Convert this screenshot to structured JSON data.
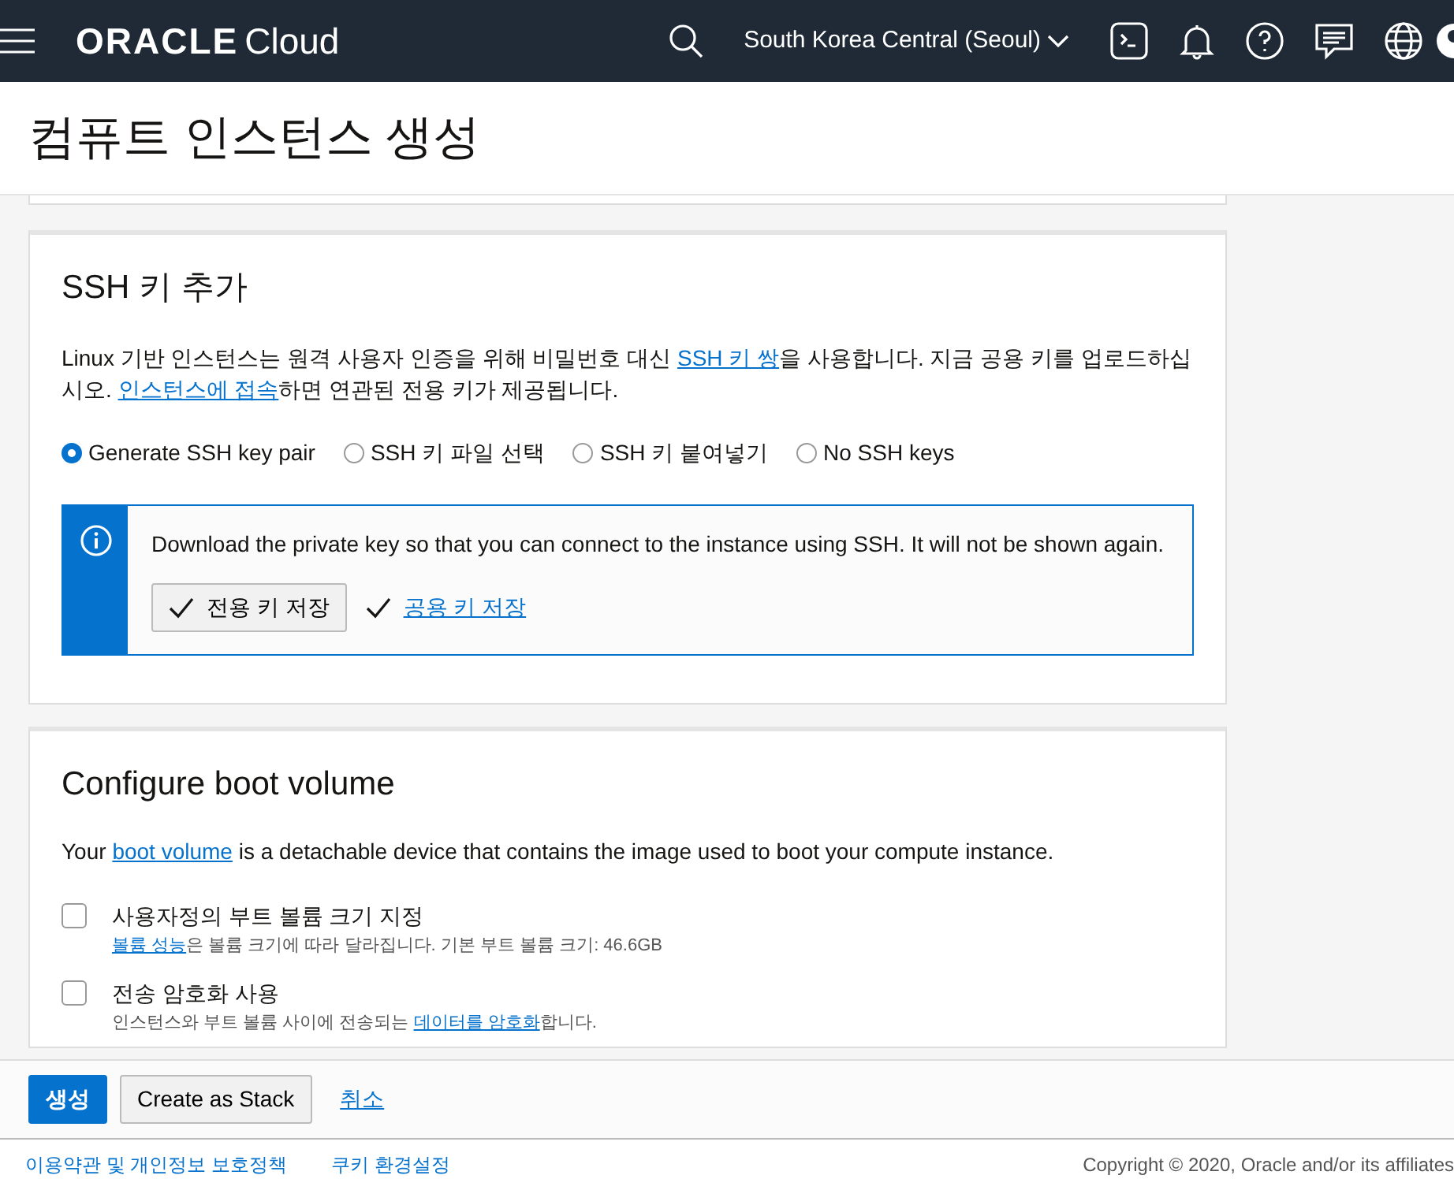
{
  "header": {
    "brand_main": "ORACLE",
    "brand_sub": "Cloud",
    "region": "South Korea Central (Seoul)"
  },
  "page_title": "컴퓨트 인스턴스 생성",
  "ssh_section": {
    "title": "SSH 키 추가",
    "description": [
      {
        "text": "Linux 기반 인스턴스는 원격 사용자 인증을 위해 비밀번호 대신 ",
        "link": false
      },
      {
        "text": "SSH 키 쌍",
        "link": true
      },
      {
        "text": "을 사용합니다. 지금 공용 키를 업로드하십시오. ",
        "link": false
      },
      {
        "text": "인스턴스에 접속",
        "link": true
      },
      {
        "text": "하면 연관된 전용 키가 제공됩니다.",
        "link": false
      }
    ],
    "options": [
      {
        "label": "Generate SSH key pair",
        "selected": true
      },
      {
        "label": "SSH 키 파일 선택",
        "selected": false
      },
      {
        "label": "SSH 키 붙여넣기",
        "selected": false
      },
      {
        "label": "No SSH keys",
        "selected": false
      }
    ],
    "alert": {
      "message": "Download the private key so that you can connect to the instance using SSH. It will not be shown again.",
      "actions": [
        {
          "kind": "button",
          "label": "전용 키 저장"
        },
        {
          "kind": "link",
          "label": "공용 키 저장"
        }
      ]
    }
  },
  "boot_section": {
    "title": "Configure boot volume",
    "description": [
      {
        "text": "Your ",
        "link": false
      },
      {
        "text": "boot volume",
        "link": true
      },
      {
        "text": " is a detachable device that contains the image used to boot your compute instance.",
        "link": false
      }
    ],
    "options": [
      {
        "label": "사용자정의 부트 볼륨 크기 지정",
        "checked": false,
        "help": [
          {
            "text": "볼륨 성능",
            "link": true
          },
          {
            "text": "은 볼륨 크기에 따라 달라집니다. 기본 부트 볼륨 크기: 46.6GB",
            "link": false
          }
        ]
      },
      {
        "label": "전송 암호화 사용",
        "checked": false,
        "help": [
          {
            "text": "인스턴스와 부트 볼륨 사이에 전송되는 ",
            "link": false
          },
          {
            "text": "데이터를 암호화",
            "link": true
          },
          {
            "text": "합니다.",
            "link": false
          }
        ]
      }
    ]
  },
  "actions": [
    {
      "kind": "primary",
      "label": "생성"
    },
    {
      "kind": "secondary",
      "label": "Create as Stack"
    },
    {
      "kind": "link",
      "label": "취소"
    }
  ],
  "footer": {
    "links": [
      "이용약관 및 개인정보 보호정책",
      "쿠키 환경설정"
    ],
    "copyright": "Copyright © 2020, Oracle and/or its affiliates"
  }
}
